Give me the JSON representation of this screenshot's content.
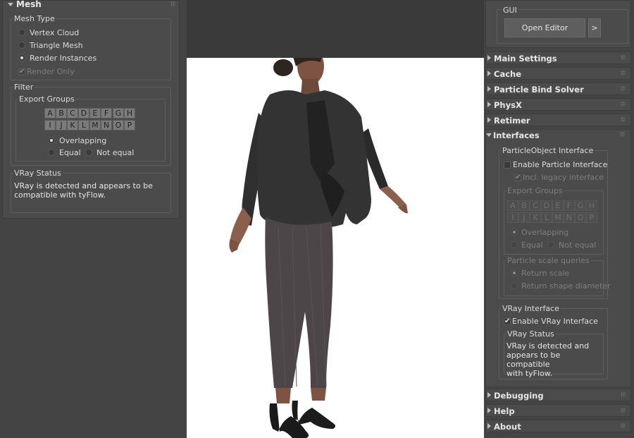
{
  "left_panel": {
    "mesh_title": "Mesh",
    "mesh_type": {
      "label": "Mesh Type",
      "options": [
        "Vertex Cloud",
        "Triangle Mesh",
        "Render Instances"
      ],
      "selected": "Render Instances",
      "render_only_label": "Render Only"
    },
    "filter": {
      "label": "Filter",
      "export_groups_label": "Export Groups",
      "letters_row1": [
        "A",
        "B",
        "C",
        "D",
        "E",
        "F",
        "G",
        "H"
      ],
      "letters_row2": [
        "I",
        "J",
        "K",
        "L",
        "M",
        "N",
        "O",
        "P"
      ],
      "overlapping_label": "Overlapping",
      "equal_label": "Equal",
      "not_equal_label": "Not equal"
    },
    "vray_status": {
      "label": "VRay Status",
      "text": "VRay is detected and appears to be\ncompatible with tyFlow."
    }
  },
  "right_panel": {
    "gui": {
      "label": "GUI",
      "open_editor_label": "Open Editor",
      "arrow_label": ">"
    },
    "rollouts": [
      "Main Settings",
      "Cache",
      "Particle Bind Solver",
      "PhysX",
      "Retimer",
      "Interfaces"
    ],
    "interfaces": {
      "particle_object": {
        "label": "ParticleObject Interface",
        "enable_label": "Enable Particle Interface",
        "legacy_label": "Incl. legacy interface",
        "export_groups_label": "Export Groups",
        "letters_row1": [
          "A",
          "B",
          "C",
          "D",
          "E",
          "F",
          "G",
          "H"
        ],
        "letters_row2": [
          "I",
          "J",
          "K",
          "L",
          "M",
          "N",
          "O",
          "P"
        ],
        "overlapping_label": "Overlapping",
        "equal_label": "Equal",
        "not_equal_label": "Not equal",
        "scale_queries_label": "Particle scale queries",
        "return_scale_label": "Return scale",
        "return_shape_label": "Return shape diameter"
      },
      "vray": {
        "label": "VRay Interface",
        "enable_label": "Enable VRay Interface",
        "status_label": "VRay Status",
        "status_text": "VRay is detected and\nappears to be compatible\nwith tyFlow."
      }
    },
    "bottom_rollouts": [
      "Debugging",
      "Help",
      "About"
    ]
  },
  "colors": {
    "panel_bg": "#444444",
    "rollout_bg": "#4b4b4b",
    "viewport_bg": "#3a3a3a",
    "render_bg": "#ffffff"
  }
}
